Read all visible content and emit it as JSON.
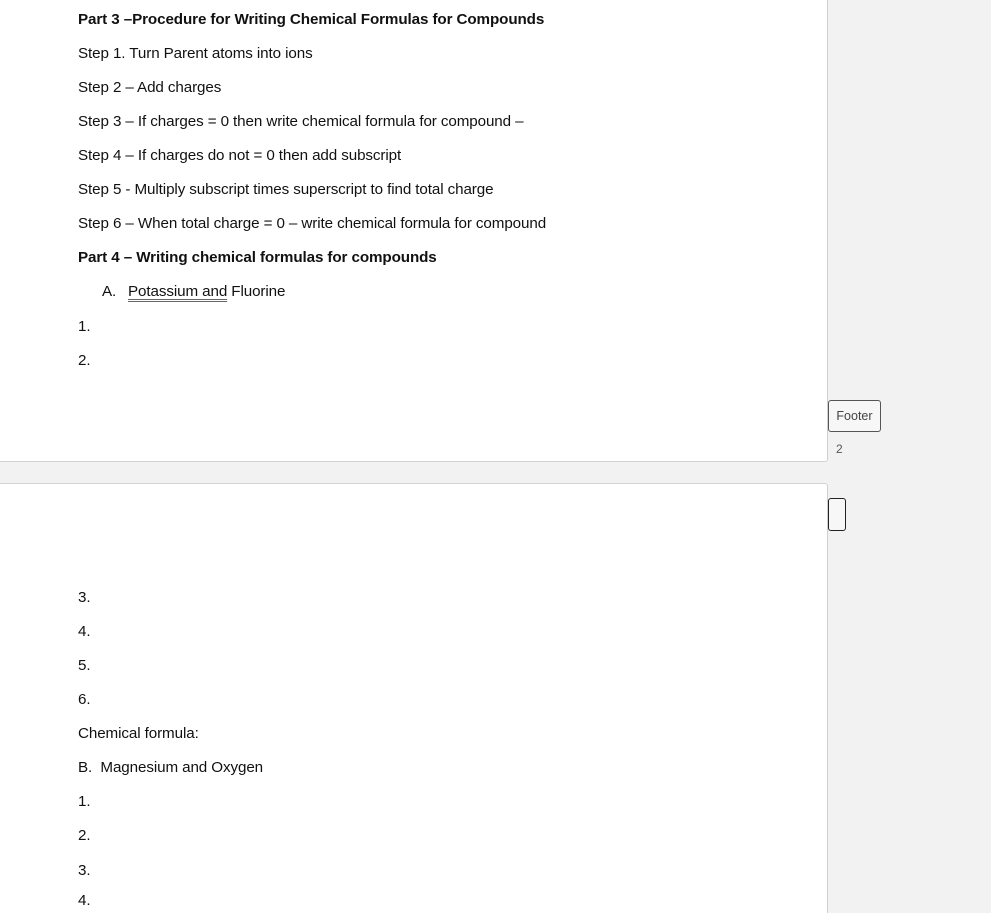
{
  "page1": {
    "lines": [
      {
        "text": "Part 3 –Procedure for Writing Chemical Formulas for Compounds",
        "bold": true
      },
      {
        "text": "Step 1. Turn Parent atoms into ions"
      },
      {
        "text": "Step 2 – Add charges"
      },
      {
        "text": "Step 3 – If charges = 0 then write chemical formula for compound –"
      },
      {
        "text": "Step 4 – If charges do not = 0 then add subscript"
      },
      {
        "text": "Step 5 - Multiply subscript times superscript to find total charge"
      },
      {
        "text": "Step 6 – When total charge = 0 – write chemical formula for compound"
      },
      {
        "text": "Part 4 – Writing chemical formulas for compounds",
        "bold": true
      }
    ],
    "item_a": {
      "letter": "A.",
      "flagged_text": "Potassium  and",
      "rest_text": " Fluorine"
    },
    "numbers": [
      "1.",
      "2."
    ]
  },
  "footer": {
    "label": "Footer",
    "page_number": "2"
  },
  "page2": {
    "numbers_a": [
      "3.",
      "4.",
      "5.",
      "6."
    ],
    "chemical_formula_label": "Chemical formula:",
    "item_b": "B.  Magnesium and Oxygen",
    "numbers_b": [
      "1.",
      "2.",
      "3.",
      "4."
    ]
  }
}
